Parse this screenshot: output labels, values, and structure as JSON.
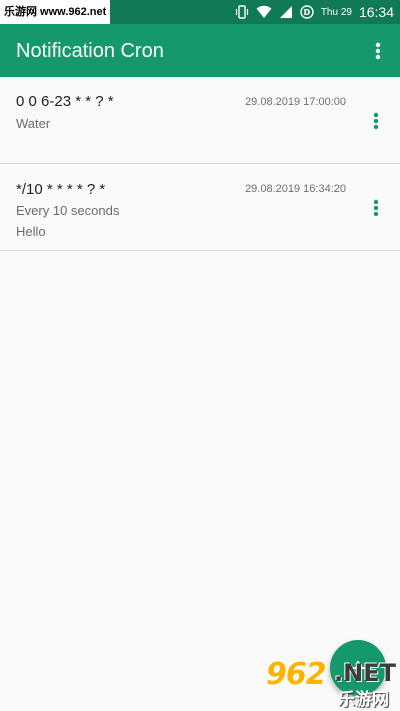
{
  "status_bar": {
    "watermark": "乐游网 www.962.net",
    "date": "Thu 29",
    "time": "16:34",
    "icons": [
      "vibrate-icon",
      "wifi-icon",
      "signal-icon",
      "data-saver-icon"
    ]
  },
  "app_bar": {
    "title": "Notification Cron",
    "menu_icon": "more-vert-icon"
  },
  "items": [
    {
      "cron": "0 0 6-23 * * ? *",
      "timestamp": "29.08.2019 17:00:00",
      "lines": [
        "Water"
      ]
    },
    {
      "cron": "*/10 * * * * ? *",
      "timestamp": "29.08.2019 16:34:20",
      "lines": [
        "Every 10 seconds",
        "Hello"
      ]
    }
  ],
  "fab": {
    "icon": "add-icon"
  },
  "watermark_logo": {
    "main": "962",
    "suffix": ".NET",
    "cn": "乐游网"
  },
  "colors": {
    "status_bar": "#0f7a55",
    "primary": "#16996a",
    "accent": "#16996a"
  }
}
